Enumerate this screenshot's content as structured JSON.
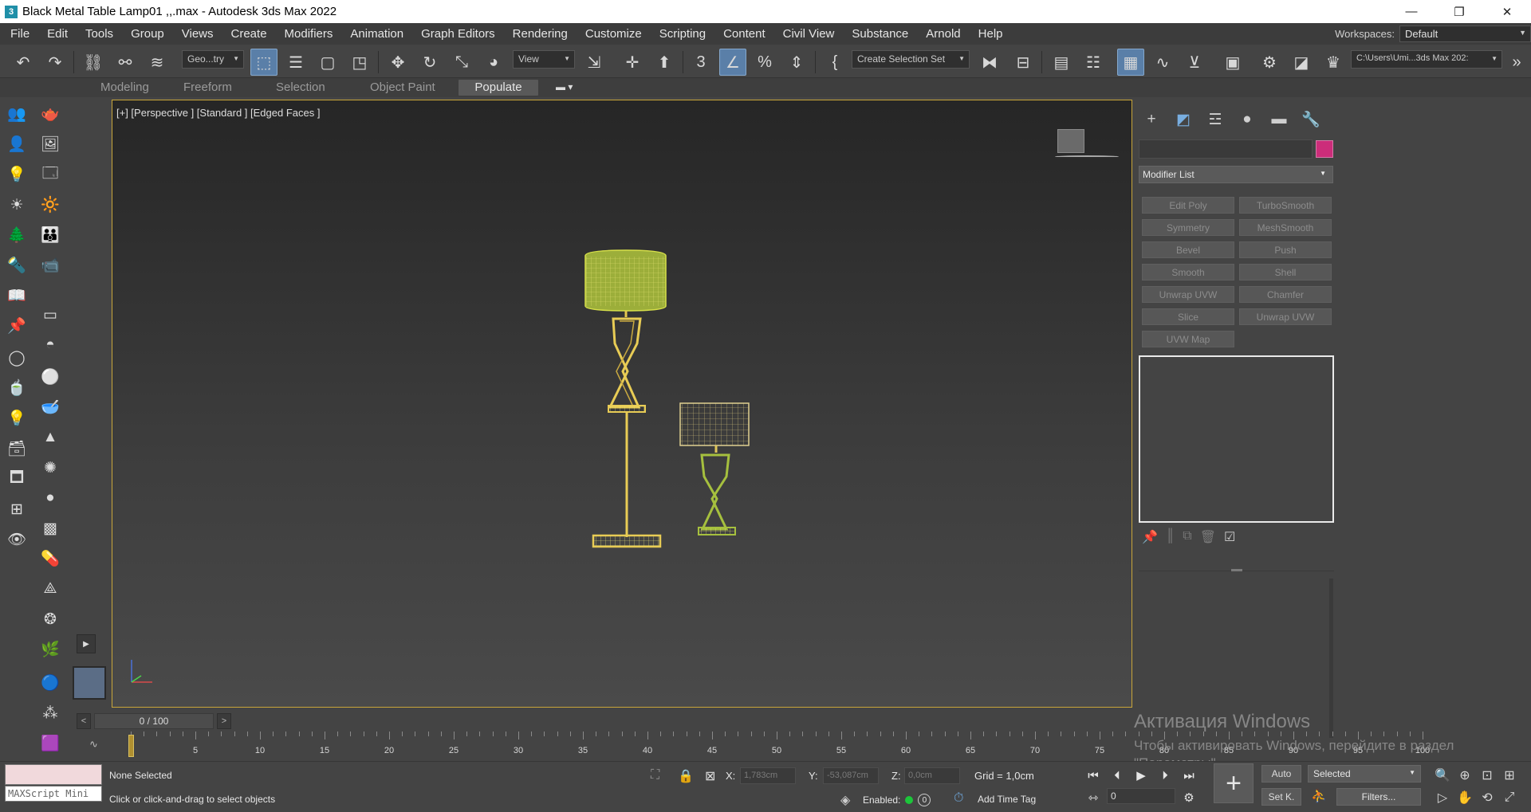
{
  "window": {
    "title": "Black Metal Table Lamp01  ,,.max - Autodesk 3ds Max 2022",
    "logo_text": "3",
    "minimize": "—",
    "restore": "❐",
    "close": "✕"
  },
  "menu": {
    "items": [
      "File",
      "Edit",
      "Tools",
      "Group",
      "Views",
      "Create",
      "Modifiers",
      "Animation",
      "Graph Editors",
      "Rendering",
      "Customize",
      "Scripting",
      "Content",
      "Civil View",
      "Substance",
      "Arnold",
      "Help"
    ],
    "workspaces_label": "Workspaces:",
    "workspace_value": "Default"
  },
  "toolbar": {
    "filter_dropdown": "Geo...try",
    "ref_coord_dropdown": "View",
    "selection_set": "Create Selection Set",
    "project_path": "C:\\Users\\Umi...3ds Max 202:"
  },
  "ribbon": {
    "tabs": [
      "Modeling",
      "Freeform",
      "Selection",
      "Object Paint",
      "Populate"
    ],
    "active_tab": "Populate"
  },
  "viewport": {
    "label": "[+] [Perspective ] [Standard ] [Edged Faces ]"
  },
  "command_panel": {
    "modifier_list": "Modifier List",
    "object_color": "#cc2d7a",
    "modifier_buttons": [
      "Edit Poly",
      "TurboSmooth",
      "Symmetry",
      "MeshSmooth",
      "Bevel",
      "Push",
      "Smooth",
      "Shell",
      "Unwrap UVW",
      "Chamfer",
      "Slice",
      "Unwrap UVW",
      "UVW Map"
    ]
  },
  "timeline": {
    "frame_counter": "0 / 100",
    "prev": "<",
    "next": ">",
    "ticks": [
      "0",
      "5",
      "10",
      "15",
      "20",
      "25",
      "30",
      "35",
      "40",
      "45",
      "50",
      "55",
      "60",
      "65",
      "70",
      "75",
      "80",
      "85",
      "90",
      "95",
      "100"
    ]
  },
  "watermark": {
    "line1": "Активация Windows",
    "line2": "Чтобы активировать Windows, перейдите в раздел \"Параметры\"."
  },
  "status": {
    "maxscript_label": "MAXScript Mini",
    "selection": "None Selected",
    "prompt": "Click or click-and-drag to select objects",
    "x_label": "X:",
    "x_value": "1,783cm",
    "y_label": "Y:",
    "y_value": "-53,087cm",
    "z_label": "Z:",
    "z_value": "0,0cm",
    "grid": "Grid = 1,0cm",
    "enabled_label": "Enabled:",
    "add_time_tag": "Add Time Tag",
    "current_frame": "0",
    "auto_key": "Auto",
    "set_key": "Set K.",
    "key_filter": "Selected",
    "filters": "Filters..."
  }
}
